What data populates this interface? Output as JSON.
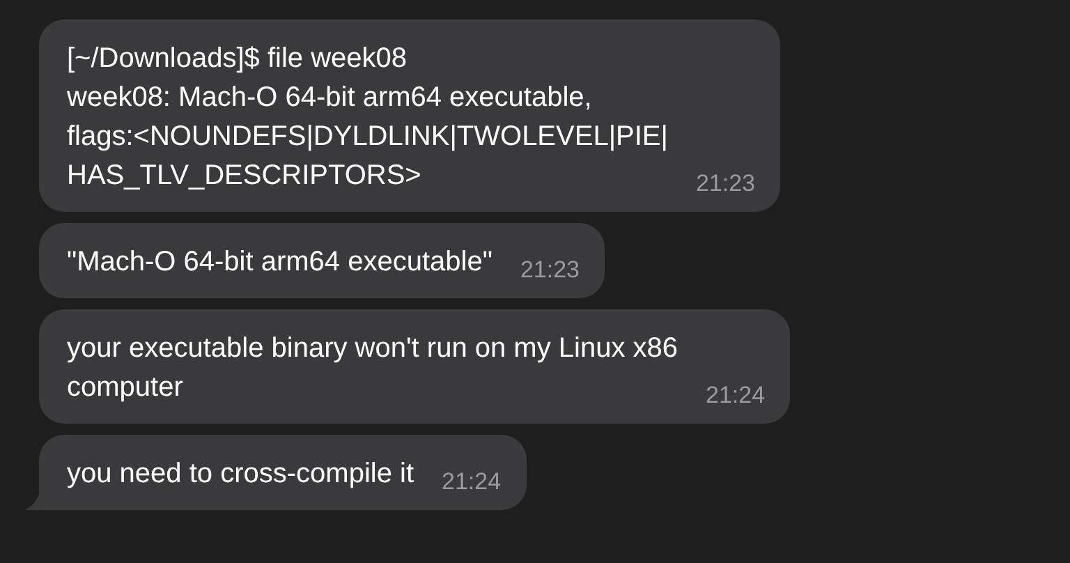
{
  "messages": [
    {
      "text": "[~/Downloads]$ file week08\nweek08: Mach-O 64-bit arm64 executable,\nflags:<NOUNDEFS|DYLDLINK|TWOLEVEL|PIE|\nHAS_TLV_DESCRIPTORS>",
      "time": "21:23",
      "tail": false
    },
    {
      "text": "\"Mach-O 64-bit arm64 executable\"",
      "time": "21:23",
      "tail": false
    },
    {
      "text": "your executable binary won't run on my Linux x86\ncomputer",
      "time": "21:24",
      "tail": false
    },
    {
      "text": "you need to cross-compile it",
      "time": "21:24",
      "tail": true
    }
  ]
}
